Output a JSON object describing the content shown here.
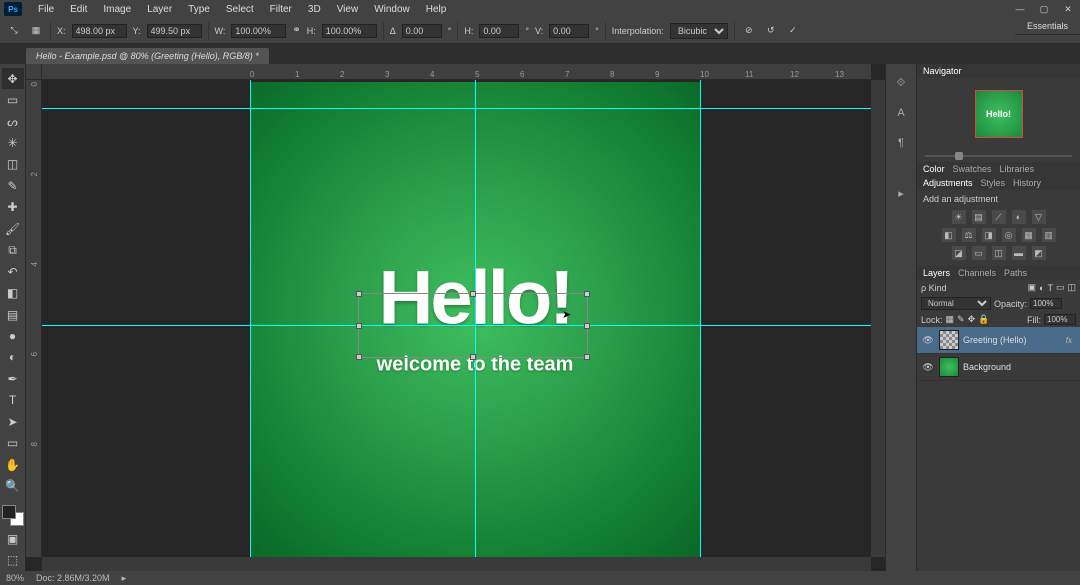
{
  "menu": [
    "File",
    "Edit",
    "Image",
    "Layer",
    "Type",
    "Select",
    "Filter",
    "3D",
    "View",
    "Window",
    "Help"
  ],
  "doc_tab": "Hello - Example.psd @ 80% (Greeting (Hello), RGB/8) *",
  "workspace": "Essentials",
  "options": {
    "x_label": "X:",
    "x": "498.00 px",
    "y_label": "Y:",
    "y": "499.50 px",
    "w_label": "W:",
    "w": "100.00%",
    "h_label": "H:",
    "h": "100.00%",
    "rot_label": "Δ",
    "rot": "0.00",
    "skh_label": "H:",
    "skh": "0.00",
    "skv_label": "V:",
    "skv": "0.00",
    "interp_label": "Interpolation:",
    "interp": "Bicubic"
  },
  "canvas": {
    "hello": "Hello!",
    "subtitle": "welcome to the team"
  },
  "ruler_h": [
    "0",
    "1",
    "2",
    "3",
    "4",
    "5",
    "6",
    "7",
    "8",
    "9",
    "10",
    "11",
    "12",
    "13"
  ],
  "ruler_v": [
    "0",
    "2",
    "4",
    "6",
    "8"
  ],
  "navigator": {
    "title": "Navigator",
    "thumb_text": "Hello!"
  },
  "color_panel": {
    "tabs": [
      "Color",
      "Swatches",
      "Libraries"
    ]
  },
  "adjustments_panel": {
    "tabs": [
      "Adjustments",
      "Styles",
      "History"
    ],
    "label": "Add an adjustment"
  },
  "layers_panel": {
    "tabs": [
      "Layers",
      "Channels",
      "Paths"
    ],
    "kind_label": "ρ Kind",
    "blend": "Normal",
    "opacity_label": "Opacity:",
    "opacity": "100%",
    "lock_label": "Lock:",
    "fill_label": "Fill:",
    "fill": "100%",
    "layers": [
      {
        "name": "Greeting (Hello)",
        "fx": "fx"
      },
      {
        "name": "Background",
        "fx": ""
      }
    ]
  },
  "status": {
    "zoom": "80%",
    "doc": "Doc: 2.86M/3.20M"
  }
}
